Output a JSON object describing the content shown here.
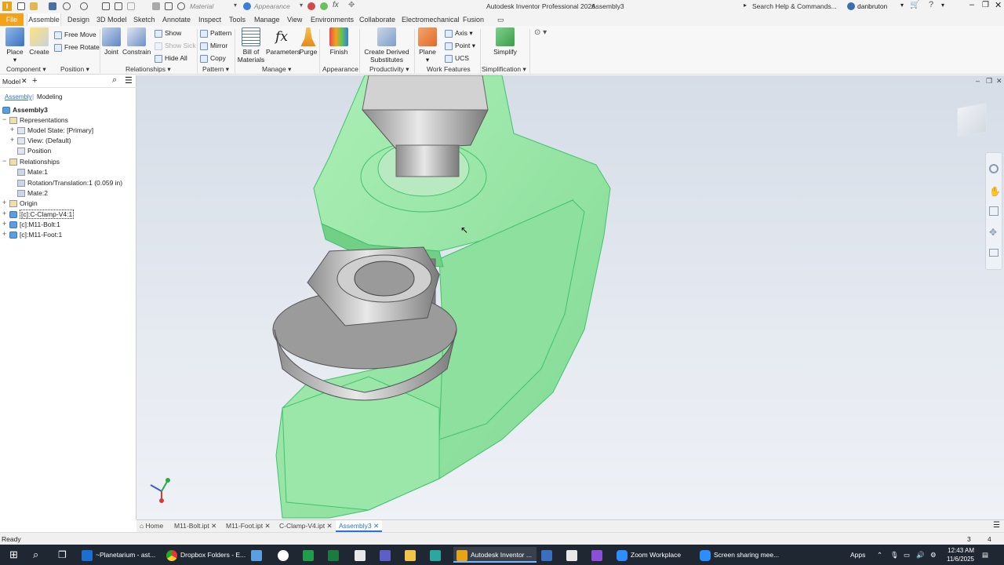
{
  "titlebar": {
    "material_label": "Material",
    "appearance_label": "Appearance",
    "app_title": "Autodesk Inventor Professional 2026",
    "doc_title": "Assembly3",
    "search_placeholder": "Search Help & Commands...",
    "user": "danbruton"
  },
  "menu": {
    "file": "File",
    "tabs": [
      "Assemble",
      "Design",
      "3D Model",
      "Sketch",
      "Annotate",
      "Inspect",
      "Tools",
      "Manage",
      "View",
      "Environments",
      "Collaborate",
      "Electromechanical",
      "Fusion"
    ],
    "active_tab": "Assemble"
  },
  "ribbon": {
    "place": "Place",
    "create": "Create",
    "free_move": "Free Move",
    "free_rotate": "Free Rotate",
    "joint": "Joint",
    "constrain": "Constrain",
    "show": "Show",
    "show_sick": "Show Sick",
    "hide_all": "Hide All",
    "pattern": "Pattern",
    "mirror": "Mirror",
    "copy": "Copy",
    "bom_line1": "Bill of",
    "bom_line2": "Materials",
    "parameters": "Parameters",
    "purge": "Purge",
    "finish": "Finish",
    "derived_line1": "Create Derived",
    "derived_line2": "Substitutes",
    "plane": "Plane",
    "axis": "Axis",
    "point": "Point",
    "ucs": "UCS",
    "simplify": "Simplify",
    "panels": {
      "component": "Component",
      "position": "Position",
      "relationships": "Relationships",
      "pattern": "Pattern",
      "manage": "Manage",
      "appearance": "Appearance",
      "productivity": "Productivity",
      "work_features": "Work Features",
      "simplification": "Simplification"
    }
  },
  "browser": {
    "tab_model": "Model",
    "sub_assembly": "Assembly",
    "sub_modeling": "Modeling",
    "root": "Assembly3",
    "items": [
      {
        "label": "Representations"
      },
      {
        "label": "Model State: [Primary]"
      },
      {
        "label": "View: (Default)"
      },
      {
        "label": "Position"
      },
      {
        "label": "Relationships"
      },
      {
        "label": "Mate:1"
      },
      {
        "label": "Rotation/Translation:1 (0.059 in)"
      },
      {
        "label": "Mate:2"
      },
      {
        "label": "Origin"
      },
      {
        "label": "[c]:C-Clamp-V4:1"
      },
      {
        "label": "[c]:M11-Bolt:1"
      },
      {
        "label": "[c]:M11-Foot:1"
      }
    ]
  },
  "doc_tabs": {
    "home": "Home",
    "tabs": [
      "M11-Bolt.ipt",
      "M11-Foot.ipt",
      "C-Clamp-V4.ipt",
      "Assembly3"
    ],
    "active": "Assembly3"
  },
  "status": {
    "text": "Ready",
    "num1": "3",
    "num2": "4"
  },
  "taskbar": {
    "items": [
      "~Planetarium - ast...",
      "Dropbox Folders - E...",
      "Autodesk Inventor ...",
      "Zoom Workplace",
      "Screen sharing mee..."
    ],
    "apps_label": "Apps",
    "time": "12:43 AM",
    "date": "11/6/2025"
  },
  "colors": {
    "accent_orange": "#f5a21b",
    "active_blue": "#2b74d1",
    "part_green": "#8ee39e",
    "taskbar": "#1f2733"
  }
}
